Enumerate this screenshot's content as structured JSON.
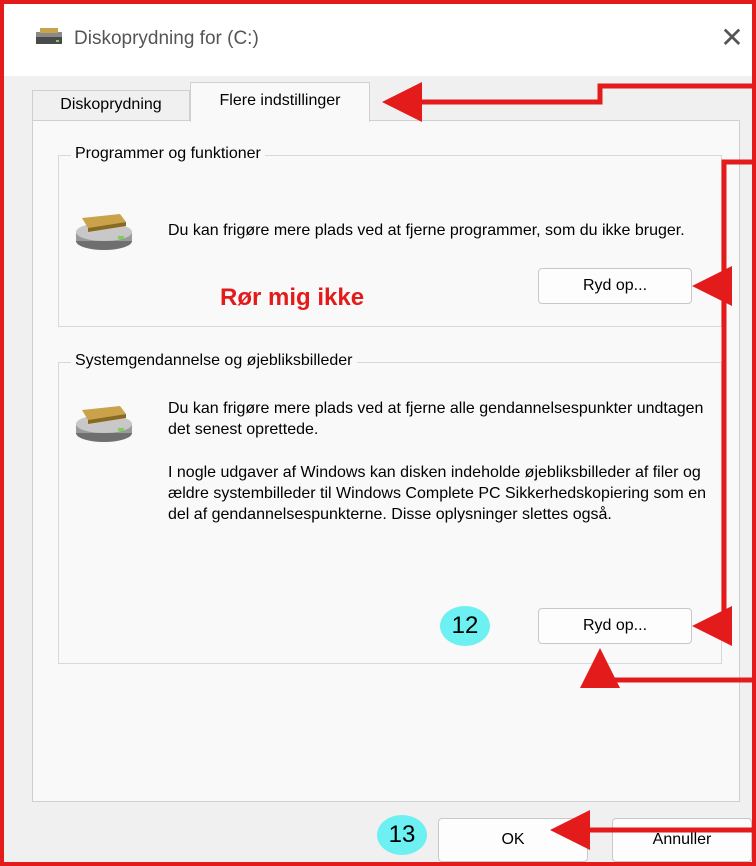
{
  "window": {
    "title": "Diskoprydning for  (C:)",
    "close_glyph": "✕",
    "icon": "disk-cleanup-icon"
  },
  "tabs": [
    {
      "label": "Diskoprydning",
      "active": false
    },
    {
      "label": "Flere indstillinger",
      "active": true
    }
  ],
  "groups": [
    {
      "title": "Programmer og funktioner",
      "description": "Du kan frigøre mere plads ved at fjerne programmer, som du ikke bruger.",
      "button_label": "Ryd op..."
    },
    {
      "title": "Systemgendannelse og øjebliksbilleder",
      "description": "Du kan frigøre mere plads ved at fjerne alle gendannelsespunkter undtagen det senest oprettede.",
      "description2": "I nogle udgaver af Windows kan disken indeholde øjebliksbilleder af filer og ældre systembilleder til Windows Complete PC Sikkerhedskopiering som en del af gendannelsespunkterne. Disse oplysninger slettes også.",
      "button_label": "Ryd op..."
    }
  ],
  "footer": {
    "ok_label": "OK",
    "cancel_label": "Annuller"
  },
  "annotations": {
    "warning_text": "Rør mig ikke",
    "badge_12": "12",
    "badge_13": "13",
    "color": "#e31b1b",
    "badge_color": "#6df0f2"
  }
}
